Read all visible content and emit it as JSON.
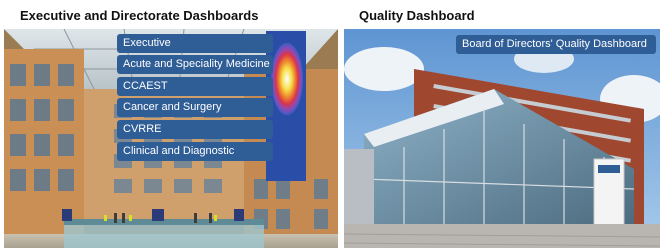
{
  "left_section": {
    "title": "Executive and Directorate Dashboards",
    "menu": [
      {
        "label": "Executive"
      },
      {
        "label": "Acute and Speciality Medicine"
      },
      {
        "label": "CCAEST"
      },
      {
        "label": "Cancer and Surgery"
      },
      {
        "label": "CVRRE"
      },
      {
        "label": "Clinical and Diagnostic"
      }
    ]
  },
  "right_section": {
    "title": "Quality Dashboard",
    "button": {
      "label": "Board of Directors' Quality Dashboard"
    }
  },
  "colors": {
    "menu_button_bg": "#2f5d96",
    "menu_button_text": "#ffffff"
  }
}
